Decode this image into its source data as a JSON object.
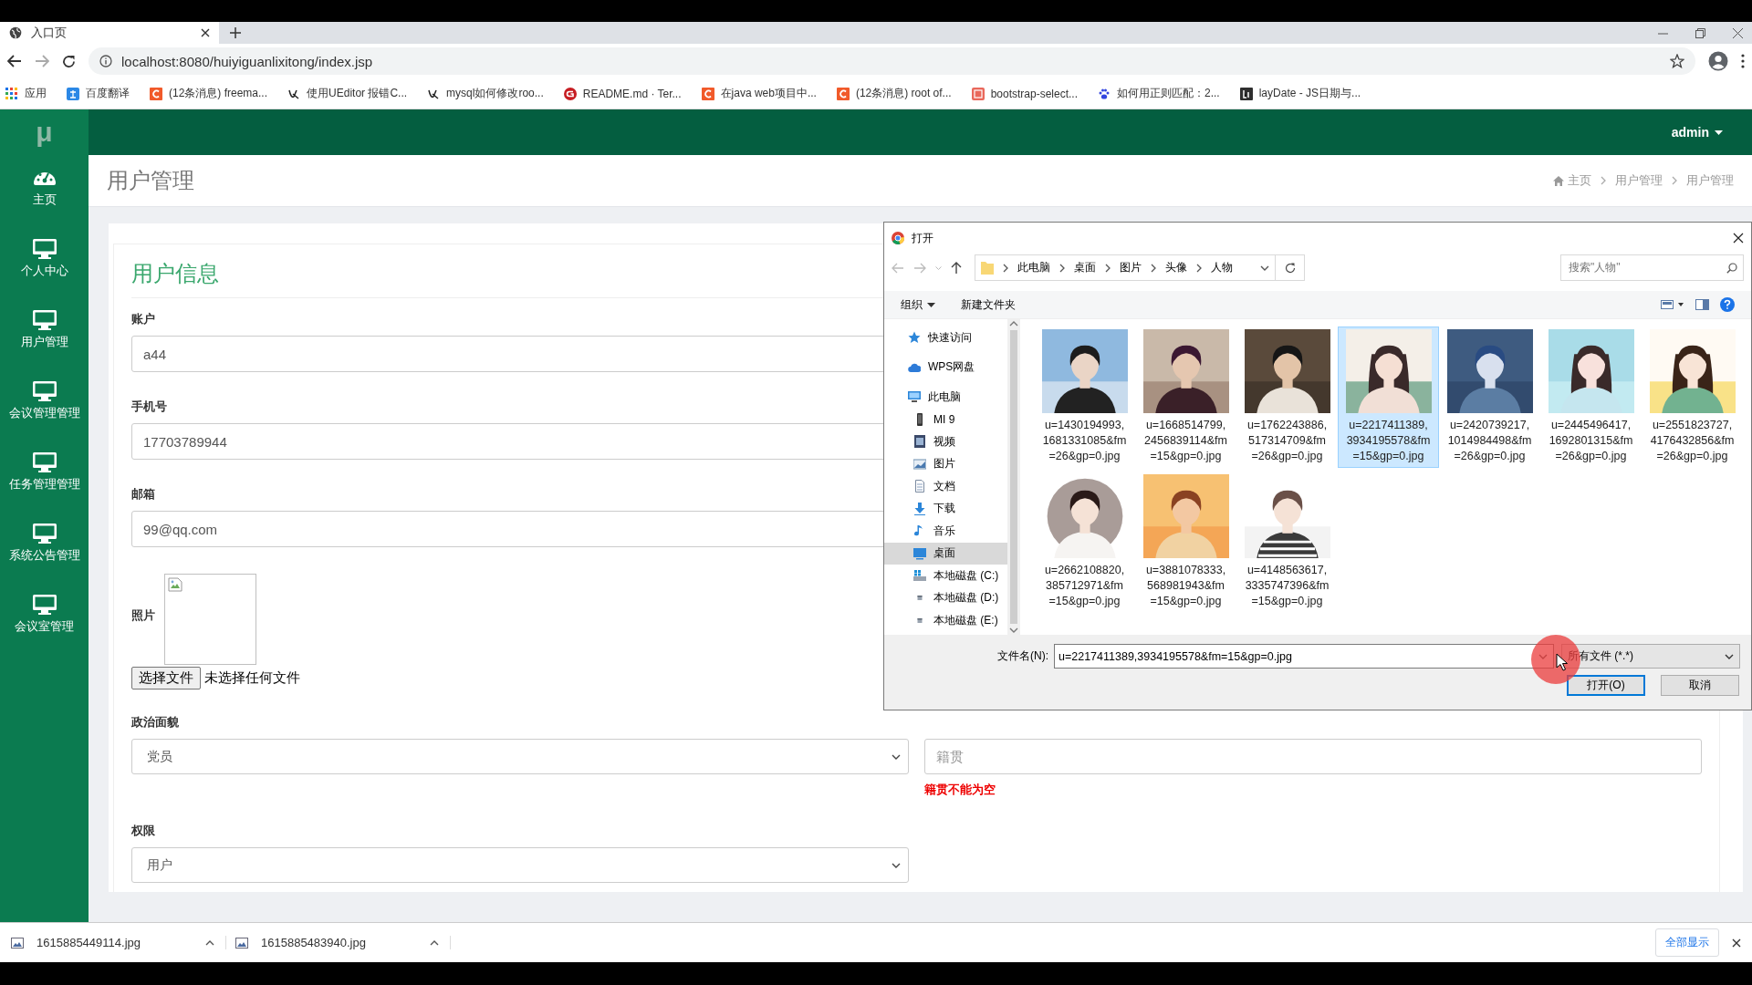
{
  "browser": {
    "tab_title": "入口页",
    "url": "localhost:8080/huiyiguanlixitong/index.jsp",
    "bookmarks": [
      {
        "label": "应用",
        "kind": "apps"
      },
      {
        "label": "百度翻译",
        "kind": "translate"
      },
      {
        "label": "(12条消息) freema...",
        "kind": "csdn"
      },
      {
        "label": "使用UEditor 报错C...",
        "kind": "ue"
      },
      {
        "label": "mysql如何修改roo...",
        "kind": "ue"
      },
      {
        "label": "README.md · Ter...",
        "kind": "gitee"
      },
      {
        "label": "在java web项目中...",
        "kind": "csdn"
      },
      {
        "label": "(12条消息) root of...",
        "kind": "csdn"
      },
      {
        "label": "bootstrap-select...",
        "kind": "jianshu"
      },
      {
        "label": "如何用正则匹配：2...",
        "kind": "paw"
      },
      {
        "label": "layDate - JS日期与...",
        "kind": "laydate"
      }
    ]
  },
  "app": {
    "logo": "μ",
    "user_menu": "admin"
  },
  "sidebar": [
    {
      "label": "主页",
      "kind": "dashboard"
    },
    {
      "label": "个人中心",
      "kind": "monitor"
    },
    {
      "label": "用户管理",
      "kind": "monitor"
    },
    {
      "label": "会议管理管理",
      "kind": "monitor"
    },
    {
      "label": "任务管理管理",
      "kind": "monitor"
    },
    {
      "label": "系统公告管理",
      "kind": "monitor"
    },
    {
      "label": "会议室管理",
      "kind": "monitor"
    }
  ],
  "page_title": "用户管理",
  "breadcrumb": [
    "主页",
    "用户管理",
    "用户管理"
  ],
  "form": {
    "title": "用户信息",
    "fields": [
      {
        "kind": "text",
        "label": "账户",
        "value": "a44"
      },
      {
        "kind": "text",
        "label": "手机号",
        "value": "17703789944"
      },
      {
        "kind": "text",
        "label": "邮箱",
        "value": "99@qq.com"
      },
      {
        "label": "照片",
        "button": "选择文件",
        "status": "未选择任何文件"
      },
      {
        "kind": "select_pair",
        "label": "政治面貌",
        "value": "党员",
        "side_placeholder": "籍贯",
        "side_error": "籍贯不能为空"
      },
      {
        "kind": "select",
        "label": "权限",
        "value": "用户"
      }
    ]
  },
  "dialog": {
    "title": "打开",
    "path": [
      "此电脑",
      "桌面",
      "图片",
      "头像",
      "人物"
    ],
    "search_placeholder": "搜索\"人物\"",
    "toolbar": [
      "组织",
      "新建文件夹"
    ],
    "nav_pane": [
      {
        "label": "快速访问",
        "kind": "star",
        "selected": false
      },
      {
        "label": "WPS网盘",
        "kind": "cloud",
        "selected": false
      },
      {
        "label": "此电脑",
        "kind": "pc",
        "selected": false,
        "children": [
          {
            "label": "MI 9",
            "kind": "phone",
            "selected": false
          },
          {
            "label": "视频",
            "kind": "video",
            "selected": false
          },
          {
            "label": "图片",
            "kind": "pictures",
            "selected": false
          },
          {
            "label": "文档",
            "kind": "document",
            "selected": false
          },
          {
            "label": "下载",
            "kind": "download",
            "selected": false
          },
          {
            "label": "音乐",
            "kind": "music",
            "selected": false
          },
          {
            "label": "桌面",
            "kind": "desktop",
            "selected": true
          },
          {
            "label": "本地磁盘 (C:)",
            "kind": "system_drive",
            "selected": false
          },
          {
            "label": "本地磁盘 (D:)",
            "kind": "drive",
            "selected": false
          },
          {
            "label": "本地磁盘 (E:)",
            "kind": "drive",
            "selected": false
          }
        ]
      }
    ],
    "files": [
      {
        "name": "u=1430194993,1681331085&fm=26&gp=0.jpg",
        "selected": false
      },
      {
        "name": "u=1668514799,2456839114&fm=15&gp=0.jpg",
        "selected": false
      },
      {
        "name": "u=1762243886,517314709&fm=26&gp=0.jpg",
        "selected": false
      },
      {
        "name": "u=2217411389,3934195578&fm=15&gp=0.jpg",
        "selected": true
      },
      {
        "name": "u=2420739217,1014984498&fm=26&gp=0.jpg",
        "selected": false
      },
      {
        "name": "u=2445496417,1692801315&fm=26&gp=0.jpg",
        "selected": false
      },
      {
        "name": "u=2551823727,4176432856&fm=26&gp=0.jpg",
        "selected": false
      },
      {
        "name": "u=2662108820,385712971&fm=15&gp=0.jpg",
        "selected": false
      },
      {
        "name": "u=3881078333,568981943&fm=15&gp=0.jpg",
        "selected": false
      },
      {
        "name": "u=4148563617,3335747396&fm=15&gp=0.jpg",
        "selected": false
      }
    ],
    "filename_label": "文件名(N):",
    "filename": "u=2217411389,3934195578&fm=15&gp=0.jpg",
    "filetype": "所有文件 (*.*)",
    "buttons": [
      "打开(O)",
      "取消"
    ]
  },
  "downloads": [
    {
      "name": "1615885449114.jpg"
    },
    {
      "name": "1615885483940.jpg"
    }
  ],
  "show_all": "全部显示"
}
